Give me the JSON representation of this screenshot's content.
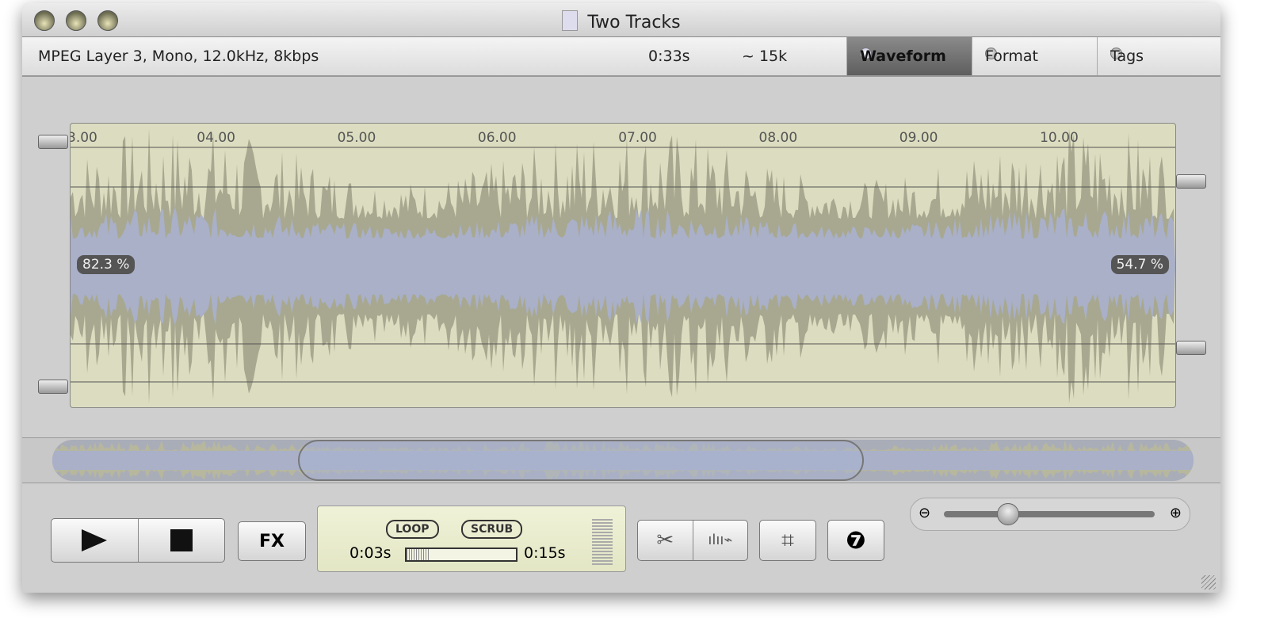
{
  "window": {
    "title": "Two Tracks"
  },
  "info": {
    "format": "MPEG Layer 3, Mono, 12.0kHz, 8kbps",
    "duration": "0:33s",
    "size": "~ 15k"
  },
  "tabs": [
    {
      "label": "Waveform",
      "active": true
    },
    {
      "label": "Format",
      "active": false
    },
    {
      "label": "Tags",
      "active": false
    }
  ],
  "waveform": {
    "ruler": [
      "3.00",
      "04.00",
      "05.00",
      "06.00",
      "07.00",
      "08.00",
      "09.00",
      "10.00"
    ],
    "left_level": "82.3 %",
    "right_level": "54.7 %",
    "colors": {
      "background": "#dcdcc0",
      "wave": "#a8a890",
      "core": "#a9b0c8"
    }
  },
  "transport": {
    "fx_label": "FX",
    "loop_label": "LOOP",
    "scrub_label": "SCRUB",
    "position": "0:03s",
    "length": "0:15s",
    "progress": 0.2
  },
  "icons": {
    "play": "play-icon",
    "stop": "stop-icon",
    "cut": "scissors-icon",
    "silence": "mute-waveform-icon",
    "crop": "crop-icon",
    "flag": "flag-icon",
    "zoom_out": "zoom-out-icon",
    "zoom_in": "zoom-in-icon"
  },
  "zoom": {
    "level": 0.3
  }
}
